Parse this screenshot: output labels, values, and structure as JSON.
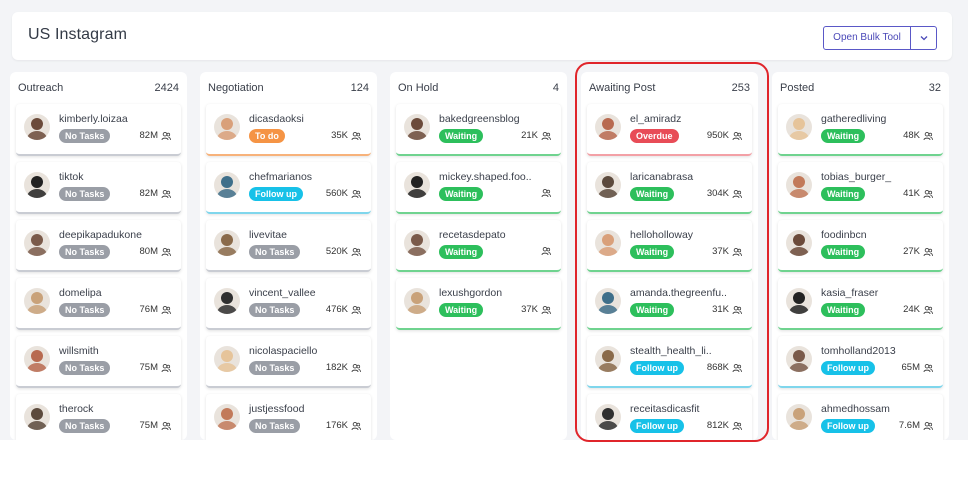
{
  "page": {
    "title": "US Instagram"
  },
  "toolbar": {
    "bulk_label": "Open Bulk Tool",
    "dropdown_icon": "chevron-down-icon"
  },
  "colors": {
    "accent": "#5a58c7",
    "no_tasks": "#9a9ea6",
    "to_do": "#f59445",
    "follow_up": "#17c1e8",
    "waiting": "#2dbf5c",
    "overdue": "#e84c57",
    "highlight_box": "#e0252b"
  },
  "columns": [
    {
      "name": "Outreach",
      "count": "2424",
      "cards": [
        {
          "handle": "kimberly.loizaa",
          "status": "No Tasks",
          "followers": "82M"
        },
        {
          "handle": "tiktok",
          "status": "No Tasks",
          "followers": "82M"
        },
        {
          "handle": "deepikapadukone",
          "status": "No Tasks",
          "followers": "80M"
        },
        {
          "handle": "domelipa",
          "status": "No Tasks",
          "followers": "76M"
        },
        {
          "handle": "willsmith",
          "status": "No Tasks",
          "followers": "75M"
        },
        {
          "handle": "therock",
          "status": "No Tasks",
          "followers": "75M"
        }
      ]
    },
    {
      "name": "Negotiation",
      "count": "124",
      "cards": [
        {
          "handle": "dicasdaoksi",
          "status": "To do",
          "followers": "35K"
        },
        {
          "handle": "chefmarianos",
          "status": "Follow up",
          "followers": "560K"
        },
        {
          "handle": "livevitae",
          "status": "No Tasks",
          "followers": "520K"
        },
        {
          "handle": "vincent_vallee",
          "status": "No Tasks",
          "followers": "476K"
        },
        {
          "handle": "nicolaspaciello",
          "status": "No Tasks",
          "followers": "182K"
        },
        {
          "handle": "justjessfood",
          "status": "No Tasks",
          "followers": "176K"
        }
      ]
    },
    {
      "name": "On Hold",
      "count": "4",
      "cards": [
        {
          "handle": "bakedgreensblog",
          "status": "Waiting",
          "followers": "21K"
        },
        {
          "handle": "mickey.shaped.foo..",
          "status": "Waiting",
          "followers": ""
        },
        {
          "handle": "recetasdepato",
          "status": "Waiting",
          "followers": ""
        },
        {
          "handle": "lexushgordon",
          "status": "Waiting",
          "followers": "37K"
        }
      ]
    },
    {
      "name": "Awaiting Post",
      "count": "253",
      "cards": [
        {
          "handle": "el_amiradz",
          "status": "Overdue",
          "followers": "950K"
        },
        {
          "handle": "laricanabrasa",
          "status": "Waiting",
          "followers": "304K"
        },
        {
          "handle": "helloholloway",
          "status": "Waiting",
          "followers": "37K"
        },
        {
          "handle": "amanda.thegreenfu..",
          "status": "Waiting",
          "followers": "31K"
        },
        {
          "handle": "stealth_health_li..",
          "status": "Follow up",
          "followers": "868K"
        },
        {
          "handle": "receitasdicasfit",
          "status": "Follow up",
          "followers": "812K"
        }
      ]
    },
    {
      "name": "Posted",
      "count": "32",
      "cards": [
        {
          "handle": "gatheredliving",
          "status": "Waiting",
          "followers": "48K"
        },
        {
          "handle": "tobias_burger_",
          "status": "Waiting",
          "followers": "41K"
        },
        {
          "handle": "foodinbcn",
          "status": "Waiting",
          "followers": "27K"
        },
        {
          "handle": "kasia_fraser",
          "status": "Waiting",
          "followers": "24K"
        },
        {
          "handle": "tomholland2013",
          "status": "Follow up",
          "followers": "65M"
        },
        {
          "handle": "ahmedhossam",
          "status": "Follow up",
          "followers": "7.6M"
        }
      ]
    }
  ]
}
